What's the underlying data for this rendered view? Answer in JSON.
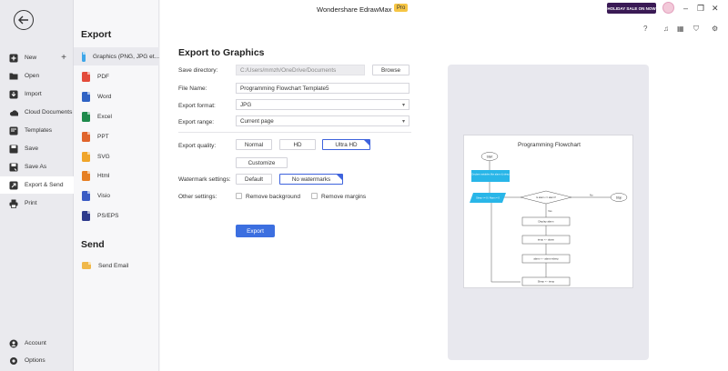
{
  "app": {
    "title": "Wondershare EdrawMax",
    "badge": "Pro",
    "promo": "HOLIDAY SALE ON NOW"
  },
  "leftnav": {
    "items": [
      {
        "label": "New",
        "icon": "plus-square-icon"
      },
      {
        "label": "Open",
        "icon": "folder-icon"
      },
      {
        "label": "Import",
        "icon": "import-icon"
      },
      {
        "label": "Cloud Documents",
        "icon": "cloud-icon"
      },
      {
        "label": "Templates",
        "icon": "templates-icon"
      },
      {
        "label": "Save",
        "icon": "save-icon"
      },
      {
        "label": "Save As",
        "icon": "save-as-icon"
      },
      {
        "label": "Export & Send",
        "icon": "export-icon"
      },
      {
        "label": "Print",
        "icon": "print-icon"
      }
    ],
    "bottom": [
      {
        "label": "Account",
        "icon": "account-icon"
      },
      {
        "label": "Options",
        "icon": "gear-icon"
      }
    ]
  },
  "export_section": {
    "title": "Export",
    "formats": [
      {
        "label": "Graphics (PNG, JPG et...",
        "color": "#3ea6e8"
      },
      {
        "label": "PDF",
        "color": "#e34b3b"
      },
      {
        "label": "Word",
        "color": "#2f62c4"
      },
      {
        "label": "Excel",
        "color": "#1e8a4c"
      },
      {
        "label": "PPT",
        "color": "#e0642c"
      },
      {
        "label": "SVG",
        "color": "#f0a52a"
      },
      {
        "label": "Html",
        "color": "#e67f23"
      },
      {
        "label": "Visio",
        "color": "#3a5bc4"
      },
      {
        "label": "PS/EPS",
        "color": "#2d3a8c"
      }
    ],
    "send_title": "Send",
    "send_items": [
      {
        "label": "Send Email",
        "color": "#f0b84a"
      }
    ]
  },
  "form": {
    "title": "Export to Graphics",
    "save_directory_label": "Save directory:",
    "save_directory_value": "C:/Users/mmzh/OneDrive/Documents",
    "browse_label": "Browse",
    "file_name_label": "File Name:",
    "file_name_value": "Programming Flowchart Template5",
    "export_format_label": "Export format:",
    "export_format_value": "JPG",
    "export_range_label": "Export range:",
    "export_range_value": "Current page",
    "quality_label": "Export quality:",
    "quality_options": [
      "Normal",
      "HD",
      "Ultra HD"
    ],
    "quality_selected": "Ultra HD",
    "customize_label": "Customize",
    "watermark_label": "Watermark settings:",
    "watermark_options": [
      "Default",
      "No watermarks"
    ],
    "watermark_selected": "No watermarks",
    "other_label": "Other settings:",
    "remove_background": "Remove background",
    "remove_margins": "Remove margins",
    "export_button": "Export"
  },
  "preview": {
    "title": "Programming Flowchart",
    "nodes": {
      "start": "Start",
      "declare": "Declare variables like alarm & sleep",
      "input": "Sleep <= 0 / Alarm = 0",
      "decision": "Is alarm <= alarm?",
      "no": "No",
      "yes": "Yes",
      "stop": "Stop",
      "display": "Display alarm",
      "temp": "temp <-- alarm",
      "alarm2": "alarm <-- alarm+sleep",
      "sleep": "Sleep <-- temp"
    },
    "accent": "#29b6e8"
  }
}
